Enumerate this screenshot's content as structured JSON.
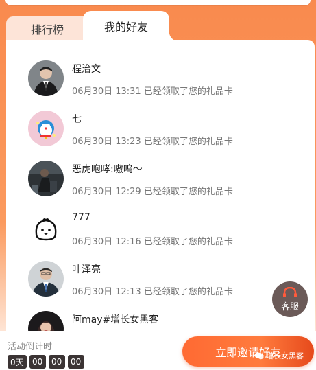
{
  "tabs": [
    {
      "label": "排行榜",
      "active": false
    },
    {
      "label": "我的好友",
      "active": true
    }
  ],
  "friends": [
    {
      "name": "程治文",
      "time": "06月30日 13:31",
      "action": "已经领取了您的礼品卡",
      "avatar": "man-in-suit"
    },
    {
      "name": "七",
      "time": "06月30日 13:23",
      "action": "已经领取了您的礼品卡",
      "avatar": "doraemon"
    },
    {
      "name": "恶虎咆哮:嗷呜～",
      "time": "06月30日 12:29",
      "action": "已经领取了您的礼品卡",
      "avatar": "person-dark"
    },
    {
      "name": "777",
      "time": "06月30日 12:16",
      "action": "已经领取了您的礼品卡",
      "avatar": "doodle-face"
    },
    {
      "name": "叶泽亮",
      "time": "06月30日 12:13",
      "action": "已经领取了您的礼品卡",
      "avatar": "man-with-glasses"
    },
    {
      "name": "阿may#增长女黑客",
      "time": "",
      "action": "",
      "avatar": "woman-portrait"
    }
  ],
  "service_button": {
    "label": "客服",
    "icon": "headset-icon"
  },
  "countdown": {
    "label": "活动倒计时",
    "days": "0天",
    "hours": "00",
    "minutes": "00",
    "seconds": "00"
  },
  "invite_button": {
    "label": "立即邀请好友"
  },
  "watermark": {
    "text": "增长女黑客",
    "icon": "wechat-icon"
  },
  "colors": {
    "accent": "#ff6a33",
    "background": "#f98a4e",
    "tab_inactive": "#fde4d8",
    "countdown_box": "#3b3434"
  }
}
